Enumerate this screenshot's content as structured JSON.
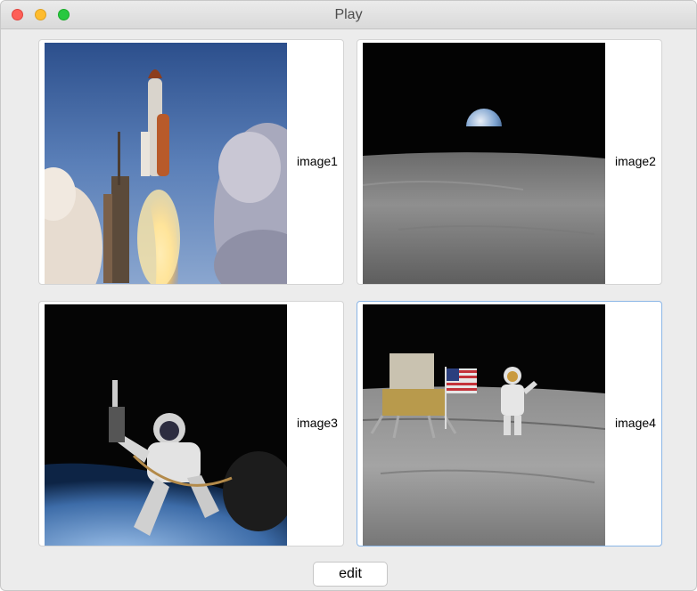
{
  "window": {
    "title": "Play"
  },
  "cards": [
    {
      "label": "image1",
      "image": "space-shuttle-launch"
    },
    {
      "label": "image2",
      "image": "earthrise-over-moon"
    },
    {
      "label": "image3",
      "image": "astronaut-spacewalk"
    },
    {
      "label": "image4",
      "image": "astronaut-moon-flag",
      "selected": true
    }
  ],
  "footer": {
    "edit_label": "edit"
  }
}
